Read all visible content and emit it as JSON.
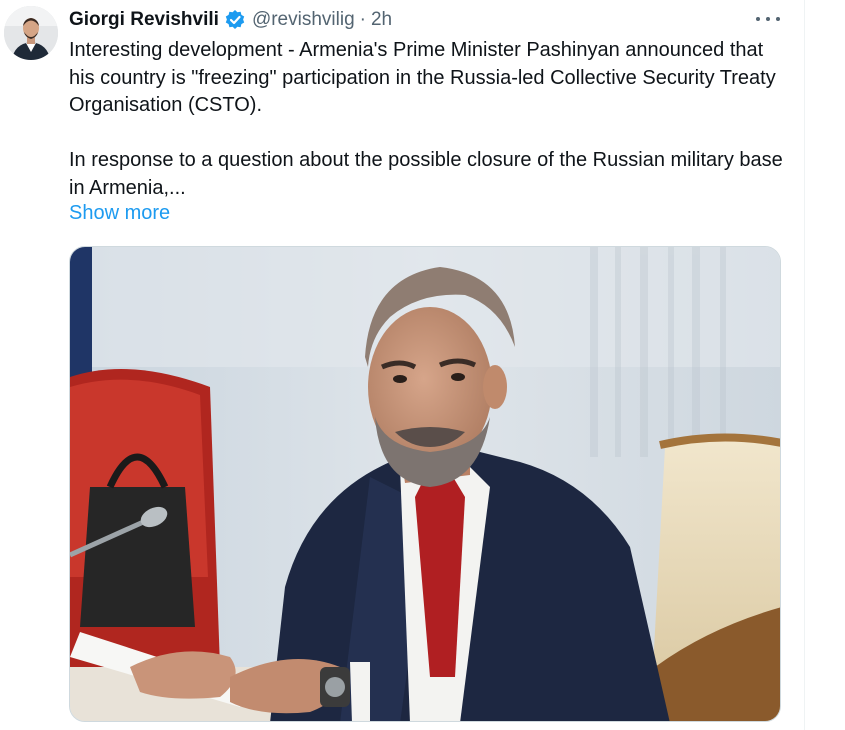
{
  "tweet": {
    "author_name": "Giorgi Revishvili",
    "handle": "@revishvilig",
    "separator": "·",
    "time": "2h",
    "paragraphs": [
      "Interesting development - Armenia's Prime Minister Pashinyan announced that his country is \"freezing\" participation in the Russia-led Collective Security Treaty Organisation (CSTO).",
      "In response to a question about the possible closure of the Russian military base in Armenia,..."
    ],
    "show_more_label": "Show more",
    "icons": {
      "verified": "verified-badge-icon",
      "more": "more-options-icon"
    },
    "colors": {
      "link": "#1d9bf0",
      "secondary_text": "#536471",
      "verified": "#1d9bf0"
    }
  }
}
